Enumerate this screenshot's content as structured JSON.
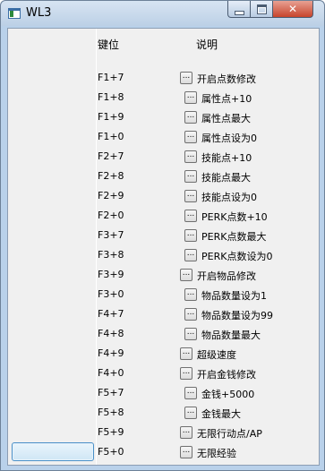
{
  "window": {
    "title": "WL3"
  },
  "table": {
    "col_key": "键位",
    "col_desc": "说明",
    "button_text": "...",
    "rows": [
      {
        "key": "F1+7",
        "desc": "开启点数修改",
        "indent": 0
      },
      {
        "key": "F1+8",
        "desc": "属性点+10",
        "indent": 1
      },
      {
        "key": "F1+9",
        "desc": "属性点最大",
        "indent": 1
      },
      {
        "key": "F1+0",
        "desc": "属性点设为0",
        "indent": 1
      },
      {
        "key": "F2+7",
        "desc": "技能点+10",
        "indent": 1
      },
      {
        "key": "F2+8",
        "desc": "技能点最大",
        "indent": 1
      },
      {
        "key": "F2+9",
        "desc": "技能点设为0",
        "indent": 1
      },
      {
        "key": "F2+0",
        "desc": "PERK点数+10",
        "indent": 1
      },
      {
        "key": "F3+7",
        "desc": "PERK点数最大",
        "indent": 1
      },
      {
        "key": "F3+8",
        "desc": "PERK点数设为0",
        "indent": 1
      },
      {
        "key": "F3+9",
        "desc": "开启物品修改",
        "indent": 0
      },
      {
        "key": "F3+0",
        "desc": "物品数量设为1",
        "indent": 1
      },
      {
        "key": "F4+7",
        "desc": "物品数量设为99",
        "indent": 1
      },
      {
        "key": "F4+8",
        "desc": "物品数量最大",
        "indent": 1
      },
      {
        "key": "F4+9",
        "desc": "超级速度",
        "indent": 0
      },
      {
        "key": "F4+0",
        "desc": "开启金钱修改",
        "indent": 0
      },
      {
        "key": "F5+7",
        "desc": "金钱+5000",
        "indent": 1
      },
      {
        "key": "F5+8",
        "desc": "金钱最大",
        "indent": 1
      },
      {
        "key": "F5+9",
        "desc": "无限行动点/AP",
        "indent": 0
      },
      {
        "key": "F5+0",
        "desc": "无限经验",
        "indent": 0
      }
    ]
  }
}
